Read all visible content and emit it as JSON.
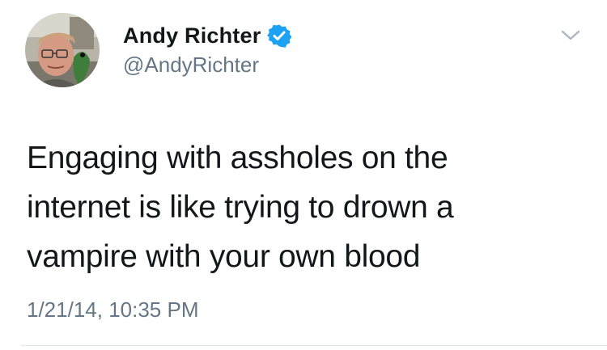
{
  "author": {
    "name": "Andy Richter",
    "handle": "@AndyRichter",
    "verified": true
  },
  "tweet": {
    "lines": [
      "Engaging with assholes on the",
      "internet is like trying to drown a",
      "vampire with your own blood"
    ],
    "timestamp": "1/21/14, 10:35 PM"
  },
  "icons": {
    "verified": "verified-badge-icon",
    "menu": "chevron-down-icon"
  },
  "colors": {
    "text": "#14171a",
    "secondary": "#657786",
    "verified_blue": "#1da1f2",
    "divider": "#e1e8ed"
  }
}
